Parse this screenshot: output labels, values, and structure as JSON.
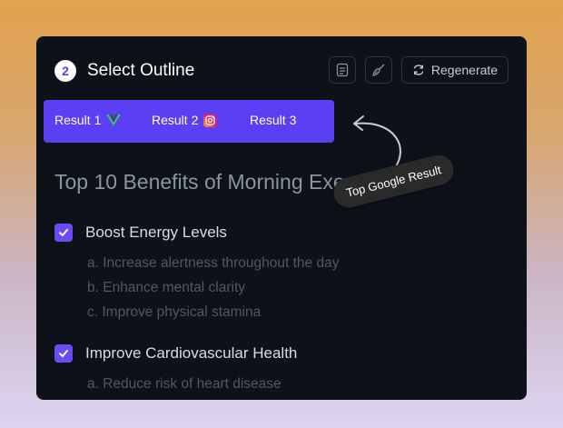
{
  "header": {
    "step": "2",
    "title": "Select Outline"
  },
  "toolbar": {
    "icon1": "document-icon",
    "icon2": "broom-icon",
    "regenerate_label": "Regenerate",
    "regenerate_icon": "refresh-icon"
  },
  "tabs": [
    {
      "label": "Result 1",
      "icon": "vue-icon"
    },
    {
      "label": "Result 2",
      "icon": "instagram-icon"
    },
    {
      "label": "Result 3"
    }
  ],
  "tooltip": "Top Google Result",
  "outline": {
    "title": "Top 10 Benefits of Morning Exe",
    "sections": [
      {
        "title": "Boost Energy Levels",
        "checked": true,
        "items": [
          "a. Increase alertness throughout the day",
          "b. Enhance mental clarity",
          "c. Improve physical stamina"
        ]
      },
      {
        "title": "Improve Cardiovascular Health",
        "checked": true,
        "items": [
          "a. Reduce risk of heart disease"
        ]
      }
    ]
  },
  "colors": {
    "accent": "#5b3ff2",
    "card_bg": "#0d1219"
  }
}
